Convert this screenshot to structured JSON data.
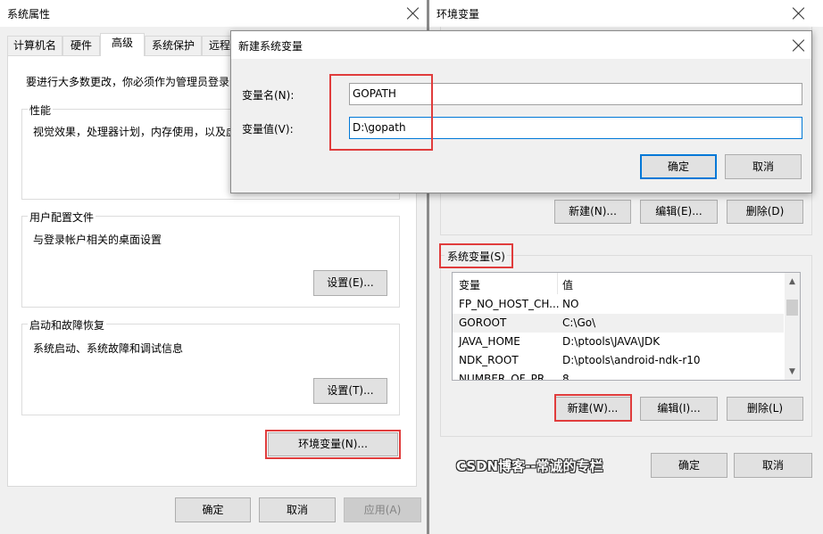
{
  "system_properties": {
    "title": "系统属性",
    "tabs": [
      "计算机名",
      "硬件",
      "高级",
      "系统保护",
      "远程"
    ],
    "admin_note": "要进行大多数更改，你必须作为管理员登录",
    "performance": {
      "title": "性能",
      "desc": "视觉效果，处理器计划，内存使用，以及虚"
    },
    "user_profiles": {
      "title": "用户配置文件",
      "desc": "与登录帐户相关的桌面设置",
      "button": "设置(E)..."
    },
    "startup_recovery": {
      "title": "启动和故障恢复",
      "desc": "系统启动、系统故障和调试信息",
      "button": "设置(T)..."
    },
    "env_button": "环境变量(N)...",
    "ok": "确定",
    "cancel": "取消",
    "apply": "应用(A)"
  },
  "env_vars": {
    "title": "环境变量",
    "user_buttons": {
      "new": "新建(N)...",
      "edit": "编辑(E)...",
      "delete": "删除(D)"
    },
    "system_title": "系统变量(S)",
    "columns": {
      "variable": "变量",
      "value": "值"
    },
    "rows": [
      {
        "variable": "FP_NO_HOST_CH...",
        "value": "NO"
      },
      {
        "variable": "GOROOT",
        "value": "C:\\Go\\"
      },
      {
        "variable": "JAVA_HOME",
        "value": "D:\\ptools\\JAVA\\JDK"
      },
      {
        "variable": "NDK_ROOT",
        "value": "D:\\ptools\\android-ndk-r10"
      },
      {
        "variable": "NUMBER_OF_PR...",
        "value": "8"
      }
    ],
    "system_buttons": {
      "new": "新建(W)...",
      "edit": "编辑(I)...",
      "delete": "删除(L)"
    },
    "watermark": "CSDN博客--常诚的专栏",
    "ok": "确定",
    "cancel": "取消"
  },
  "new_var_dialog": {
    "title": "新建系统变量",
    "name_label": "变量名(N):",
    "name_value": "GOPATH",
    "value_label": "变量值(V):",
    "value_value": "D:\\gopath",
    "ok": "确定",
    "cancel": "取消"
  },
  "colors": {
    "highlight_red": "#e03c3c",
    "accent_blue": "#0078d7",
    "window_bg": "#f0f0f0"
  }
}
